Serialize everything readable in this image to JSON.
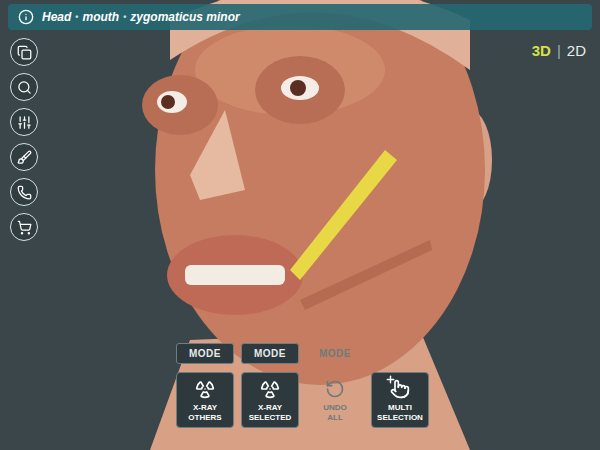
{
  "breadcrumb": {
    "items": [
      "Head",
      "mouth",
      "zygomaticus minor"
    ],
    "separator": "•"
  },
  "view_toggle": {
    "options": [
      {
        "label": "3D",
        "selected": true
      },
      {
        "label": "2D",
        "selected": false
      }
    ],
    "separator": "|"
  },
  "mode_labels": [
    {
      "label": "MODE",
      "disabled": false
    },
    {
      "label": "MODE",
      "disabled": false
    },
    {
      "label": "MODE",
      "disabled": true
    }
  ],
  "tools": [
    {
      "kind": "xray",
      "lines": [
        "X-RAY",
        "OTHERS"
      ],
      "disabled": false
    },
    {
      "kind": "xray",
      "lines": [
        "X-RAY",
        "SELECTED"
      ],
      "disabled": false
    },
    {
      "kind": "undo",
      "lines": [
        "UNDO",
        "ALL"
      ],
      "disabled": true
    },
    {
      "kind": "multi",
      "lines": [
        "MULTI",
        "SELECTION"
      ],
      "disabled": false
    }
  ]
}
